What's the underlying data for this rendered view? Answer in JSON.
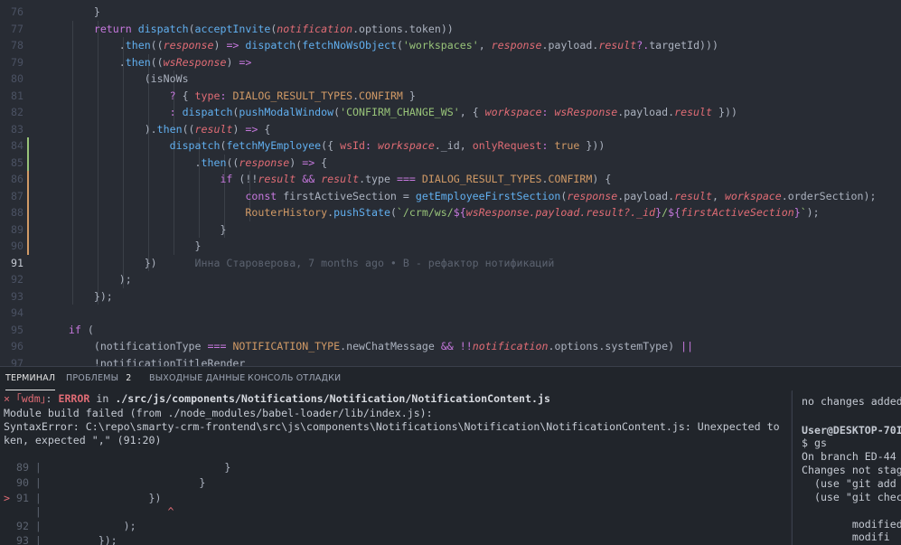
{
  "editor": {
    "lines": [
      {
        "n": "76",
        "text": "        }"
      },
      {
        "n": "77",
        "text": "        return dispatch(acceptInvite(notification.options.token))"
      },
      {
        "n": "78",
        "text": "            .then((response) => dispatch(fetchNoWsObject('workspaces', response.payload.result?.targetId)))"
      },
      {
        "n": "79",
        "text": "            .then((wsResponse) =>"
      },
      {
        "n": "80",
        "text": "                (isNoWs"
      },
      {
        "n": "81",
        "text": "                    ? { type: DIALOG_RESULT_TYPES.CONFIRM }"
      },
      {
        "n": "82",
        "text": "                    : dispatch(pushModalWindow('CONFIRM_CHANGE_WS', { workspace: wsResponse.payload.result }))"
      },
      {
        "n": "83",
        "text": "                ).then((result) => {"
      },
      {
        "n": "84",
        "text": "                    dispatch(fetchMyEmployee({ wsId: workspace._id, onlyRequest: true }))"
      },
      {
        "n": "85",
        "text": "                        .then((response) => {"
      },
      {
        "n": "86",
        "text": "                            if (!!result && result.type === DIALOG_RESULT_TYPES.CONFIRM) {"
      },
      {
        "n": "87",
        "text": "                                const firstActiveSection = getEmployeeFirstSection(response.payload.result, workspace.orderSection);"
      },
      {
        "n": "88",
        "text": "                                RouterHistory.pushState(`/crm/ws/${wsResponse.payload.result?._id}/${firstActiveSection}`);"
      },
      {
        "n": "89",
        "text": "                            }"
      },
      {
        "n": "90",
        "text": "                        }"
      },
      {
        "n": "91",
        "text": "                })"
      },
      {
        "n": "92",
        "text": "            );"
      },
      {
        "n": "93",
        "text": "        });"
      },
      {
        "n": "94",
        "text": ""
      },
      {
        "n": "95",
        "text": "    if ("
      },
      {
        "n": "96",
        "text": "        (notificationType === NOTIFICATION_TYPE.newChatMessage && !!notification.options.systemType) ||"
      },
      {
        "n": "97",
        "text": "        !notificationTitleRender"
      }
    ],
    "blame": "Инна Староверова, 7 months ago • В - рефактор нотификаций"
  },
  "panel": {
    "tabs": [
      {
        "label": "ТЕРМИНАЛ"
      },
      {
        "label": "ПРОБЛЕМЫ"
      },
      {
        "label": "ВЫХОДНЫЕ ДАННЫЕ"
      },
      {
        "label": "КОНСОЛЬ ОТЛАДКИ"
      }
    ],
    "problems_count": "2"
  },
  "terminal": {
    "error_prefix": "× ｢wdm｣",
    "error_colon": ":",
    "error_word": "ERROR",
    "error_in": "in",
    "error_path": "./src/js/components/Notifications/Notification/NotificationContent.js",
    "build_failed": "Module build failed (from ./node_modules/babel-loader/lib/index.js):",
    "syntax_error": "SyntaxError: C:\\repo\\smarty-crm-frontend\\src\\js\\components\\Notifications\\Notification\\NotificationContent.js: Unexpected to",
    "syntax_error_cont": "ken, expected \",\" (91:20)",
    "frame": [
      {
        "marker": "",
        "n": "89",
        "code": "                            }"
      },
      {
        "marker": "",
        "n": "90",
        "code": "                        }"
      },
      {
        "marker": ">",
        "n": "91",
        "code": "                })"
      },
      {
        "marker": "",
        "n": "",
        "code": "                   ^"
      },
      {
        "marker": "",
        "n": "92",
        "code": "            );"
      },
      {
        "marker": "",
        "n": "93",
        "code": "        });"
      }
    ]
  },
  "terminal_right": {
    "lines": [
      "no changes added",
      "",
      "User@DESKTOP-70I",
      "$ gs",
      "On branch ED-44",
      "Changes not stag",
      "  (use \"git add",
      "  (use \"git chec",
      "",
      "        modified",
      "        modifi"
    ]
  },
  "colors": {
    "editor_bg": "#282c34",
    "keyword": "#c678dd",
    "function": "#61afef",
    "variable": "#e06c75",
    "string": "#98c379",
    "constant": "#d19a66",
    "operator": "#56b6c2",
    "error": "#e06c75",
    "prompt_green": "#98c379"
  }
}
